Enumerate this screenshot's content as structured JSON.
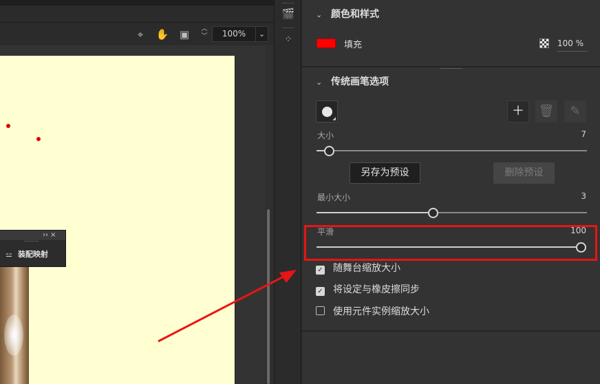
{
  "stage_toolbar": {
    "zoom_value": "100%",
    "icons": [
      "crosshair-icon",
      "hand-icon",
      "clip-icon"
    ]
  },
  "mini_panel": {
    "title_icons": "›› ×",
    "item_label": "装配映射"
  },
  "right_panel": {
    "color_section": {
      "title": "颜色和样式",
      "fill_label": "填充",
      "fill_color": "#ff0000",
      "alpha_value": "100 %"
    },
    "brush_section": {
      "title": "传统画笔选项",
      "size": {
        "label": "大小",
        "value": "7"
      },
      "save_preset": "另存为预设",
      "delete_preset": "删除预设",
      "min_size": {
        "label": "最小大小",
        "value": "3"
      },
      "smoothing": {
        "label": "平滑",
        "value": "100"
      },
      "options": [
        {
          "label": "随舞台缩放大小",
          "checked": true
        },
        {
          "label": "将设定与橡皮擦同步",
          "checked": true
        },
        {
          "label": "使用元件实例缩放大小",
          "checked": false
        }
      ]
    }
  },
  "annotation": {
    "color": "#e81515"
  }
}
